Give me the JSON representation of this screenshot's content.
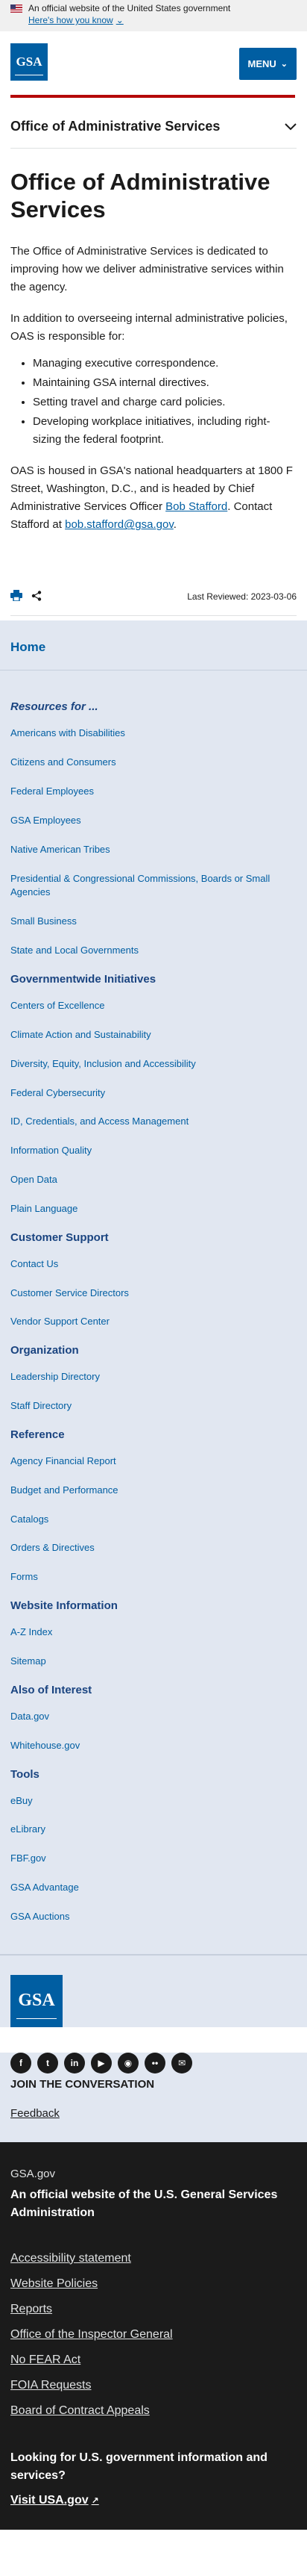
{
  "gov_banner": {
    "official_text": "An official website of the United States government",
    "how_link": "Here's how you know"
  },
  "header": {
    "logo_text": "GSA",
    "menu_label": "MENU"
  },
  "section_nav": {
    "title": "Office of Administrative Services"
  },
  "main": {
    "title": "Office of Administrative Services",
    "intro": "The Office of Administrative Services is dedicated to improving how we deliver administrative services within the agency.",
    "lead_in": "In addition to overseeing internal administrative policies, OAS is responsible for:",
    "bullets": [
      "Managing executive correspondence.",
      "Maintaining GSA internal directives.",
      "Setting travel and charge card policies.",
      "Developing workplace initiatives, including right-sizing the federal footprint."
    ],
    "contact_pre": "OAS is housed in GSA's national headquarters at 1800 F Street, Washington, D.C., and is headed by Chief Administrative Services Officer ",
    "contact_name": "Bob Stafford",
    "contact_mid": ". Contact Stafford at ",
    "contact_email": "bob.stafford@gsa.gov",
    "contact_post": "."
  },
  "tools": {
    "last_reviewed": "Last Reviewed: 2023-03-06"
  },
  "sitenav": {
    "home": "Home",
    "groups": [
      {
        "heading": "Resources for ...",
        "italic": true,
        "items": [
          "Americans with Disabilities",
          "Citizens and Consumers",
          "Federal Employees",
          "GSA Employees",
          "Native American Tribes",
          "Presidential & Congressional Commissions, Boards or Small Agencies",
          "Small Business",
          "State and Local Governments"
        ]
      },
      {
        "heading": "Governmentwide Initiatives",
        "items": [
          "Centers of Excellence",
          "Climate Action and Sustainability",
          "Diversity, Equity, Inclusion and Accessibility",
          "Federal Cybersecurity",
          "ID, Credentials, and Access Management",
          "Information Quality",
          "Open Data",
          "Plain Language"
        ]
      },
      {
        "heading": "Customer Support",
        "items": [
          "Contact Us",
          "Customer Service Directors",
          "Vendor Support Center"
        ]
      },
      {
        "heading": "Organization",
        "items": [
          "Leadership Directory",
          "Staff Directory"
        ]
      },
      {
        "heading": "Reference",
        "items": [
          "Agency Financial Report",
          "Budget and Performance",
          "Catalogs",
          "Orders & Directives",
          "Forms"
        ]
      },
      {
        "heading": "Website Information",
        "items": [
          "A-Z Index",
          "Sitemap"
        ]
      },
      {
        "heading": "Also of Interest",
        "items": [
          "Data.gov",
          "Whitehouse.gov"
        ]
      },
      {
        "heading": "Tools",
        "items": [
          "eBuy",
          "eLibrary",
          "FBF.gov",
          "GSA Advantage",
          "GSA Auctions"
        ]
      }
    ]
  },
  "footer": {
    "logo_text": "GSA",
    "social_icons": [
      "facebook-icon",
      "twitter-icon",
      "linkedin-icon",
      "youtube-icon",
      "instagram-icon",
      "flickr-icon",
      "email-icon"
    ],
    "join": "JOIN THE CONVERSATION",
    "feedback": "Feedback",
    "domain_label": "GSA.gov",
    "official": "An official website of the U.S. General Services Administration",
    "links": [
      "Accessibility statement",
      "Website Policies",
      "Reports",
      "Office of the Inspector General",
      "No FEAR Act",
      "FOIA Requests",
      "Board of Contract Appeals"
    ],
    "question": "Looking for U.S. government information and services?",
    "usa_link": "Visit USA.gov"
  }
}
